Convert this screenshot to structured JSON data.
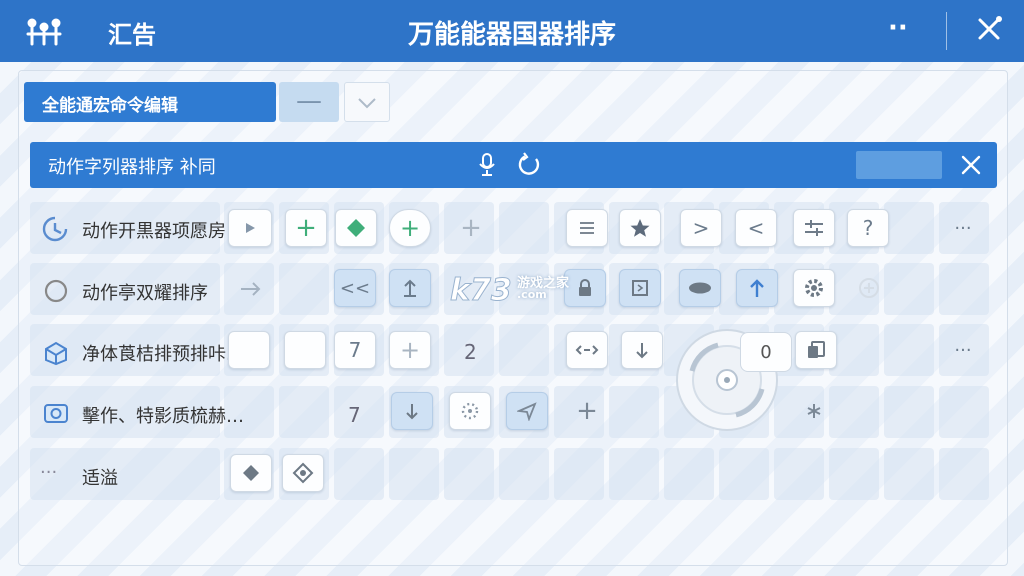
{
  "titlebar": {
    "tools_label": "汇告",
    "title": "万能能器国器排序",
    "menu_glyph": "··",
    "close_glyph": "✕"
  },
  "macro": {
    "selected": "全能通宏命令编辑",
    "minus_label": "—"
  },
  "sequence": {
    "label": "动作字列器排序 补同"
  },
  "rows": [
    {
      "label": "动作开黒器项愿房"
    },
    {
      "label": "动作亭双耀排序"
    },
    {
      "label": "净体莨桔排预排咔."
    },
    {
      "label": "擊作、特影质梳赫…"
    },
    {
      "label": "适溢"
    }
  ],
  "values": {
    "r3_a": "7",
    "r3_b": "2",
    "r3_knob": "0",
    "r4_a": "7"
  },
  "glyphs": {
    "plus": "+",
    "more": "···",
    "prev": "<<",
    "arrow_right": ">",
    "arrow_left": "<",
    "question": "?"
  },
  "watermark": {
    "logo": "k73",
    "sub": "游戏之家",
    "domain": ".com"
  },
  "colors": {
    "titlebar": "#2e74c8",
    "accent": "#2f7bd2",
    "green": "#3fae7a"
  }
}
